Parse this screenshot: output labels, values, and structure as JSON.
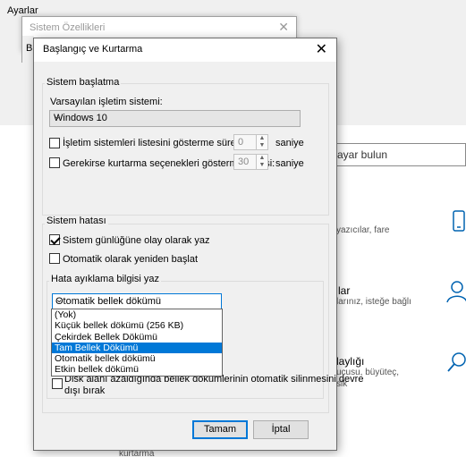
{
  "settings": {
    "title": "Ayarlar",
    "search_text": "ayar bulun",
    "tiles": [
      {
        "title": "",
        "sub": "yazıcılar, fare"
      },
      {
        "title": "lar",
        "sub": "larınız, isteğe bağlı"
      },
      {
        "title": "laylığı",
        "sub": "ucusu, büyüteç,\nsik"
      }
    ],
    "footer_text": "kurtarma"
  },
  "props_window": {
    "title": "Sistem Özellikleri",
    "strip_text": "B"
  },
  "dialog": {
    "title": "Başlangıç ve Kurtarma",
    "startup": {
      "group_label": "Sistem başlatma",
      "default_os_label": "Varsayılan işletim sistemi:",
      "default_os_value": "Windows 10",
      "show_os_list_label": "İşletim sistemleri listesini gösterme süresi:",
      "show_os_list_value": "0",
      "show_os_list_unit": "saniye",
      "show_recovery_label": "Gerekirse kurtarma seçenekleri gösterme süresi:",
      "show_recovery_value": "30",
      "show_recovery_unit": "saniye"
    },
    "failure": {
      "group_label": "Sistem hatası",
      "write_event_label": "Sistem günlüğüne olay olarak yaz",
      "auto_restart_label": "Otomatik olarak yeniden başlat",
      "debug_group_label": "Hata ayıklama bilgisi yaz",
      "debug_selected": "Otomatik bellek dökümü",
      "debug_options": [
        "(Yok)",
        "Küçük bellek dökümü (256 KB)",
        "Çekirdek Bellek Dökümü",
        "Tam Bellek Dökümü",
        "Otomatik bellek dökümü",
        "Etkin bellek dökümü"
      ],
      "debug_highlighted_index": 3,
      "disable_auto_delete_label_line1": "Disk alanı azaldığında bellek dökümlerinin otomatik silinmesini devre",
      "disable_auto_delete_label_line2": "dışı bırak"
    },
    "ok_label": "Tamam",
    "cancel_label": "İptal"
  }
}
